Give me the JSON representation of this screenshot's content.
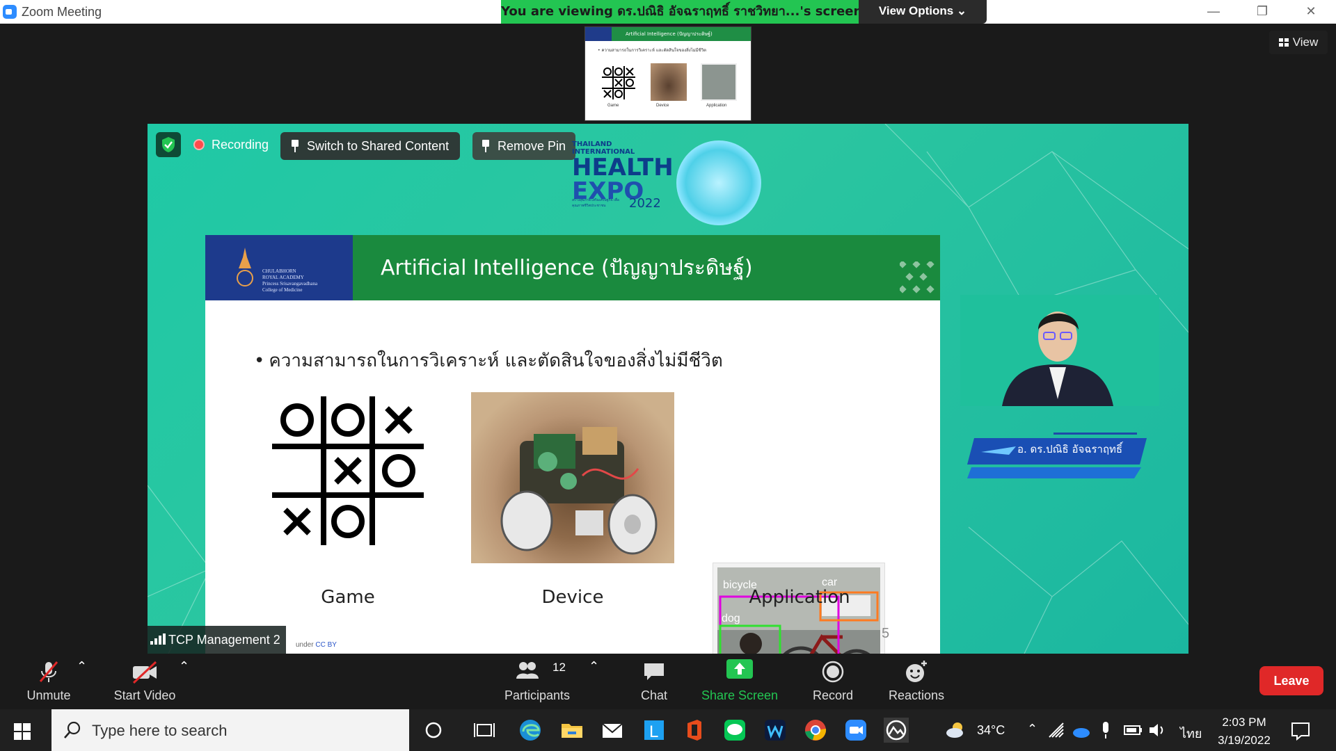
{
  "window": {
    "app_title": "Zoom Meeting",
    "viewing_banner": "You are viewing ดร.ปณิธิ อัจฉราฤทธิ์ ราชวิทยา...'s screen",
    "view_options": "View Options",
    "view_button": "View"
  },
  "thumbnail": {
    "header": "Artificial Intelligence (ปัญญาประดิษฐ์)",
    "bullet": "• ความสามารถในการวิเคราะห์ และตัดสินใจของสิ่งไม่มีชีวิต",
    "captions": [
      "Game",
      "Device",
      "Application"
    ]
  },
  "stage": {
    "recording_label": "Recording",
    "switch_shared": "Switch to Shared Content",
    "remove_pin": "Remove Pin",
    "expo": {
      "line1": "THAILAND INTERNATIONAL",
      "line2": "HEALTH",
      "line3": "EXPO",
      "year": "2022",
      "tagline": "สร้างสุขภาพ เสริมเศรษฐกิจ เพื่อคุณภาพชีวิตประชาชน"
    },
    "slide": {
      "logo_text": [
        "CHULABHORN",
        "ROYAL ACADEMY",
        "Princess Srisavangavadhana",
        "College of Medicine"
      ],
      "title": "Artificial Intelligence (ปัญญาประดิษฐ์)",
      "bullet": "ความสามารถในการวิเคราะห์ และตัดสินใจของสิ่งไม่มีชีวิต",
      "captions": [
        "Game",
        "Device",
        "Application"
      ],
      "tictactoe": [
        "O",
        "O",
        "X",
        "",
        "X",
        "O",
        "X",
        "O",
        ""
      ],
      "detections": [
        "bicycle",
        "car",
        "dog"
      ],
      "page_number": "5",
      "license_prefix": "under",
      "license_link": "CC BY"
    },
    "presenter_name": "อ. ดร.ปณิธิ อัจฉราฤทธิ์",
    "participant_label": "TCP Management 2"
  },
  "toolbar": {
    "unmute": "Unmute",
    "start_video": "Start Video",
    "participants": "Participants",
    "participants_count": "12",
    "chat": "Chat",
    "share_screen": "Share Screen",
    "record": "Record",
    "reactions": "Reactions",
    "leave": "Leave"
  },
  "taskbar": {
    "search_placeholder": "Type here to search",
    "weather": "34°C",
    "language": "ไทย",
    "time": "2:03 PM",
    "date": "3/19/2022"
  },
  "colors": {
    "share_green": "#23c552",
    "leave_red": "#e02828",
    "stage_teal": "#1fc9a6",
    "slide_header_green": "#1a8a3e",
    "logo_blue": "#1d3a8c"
  }
}
